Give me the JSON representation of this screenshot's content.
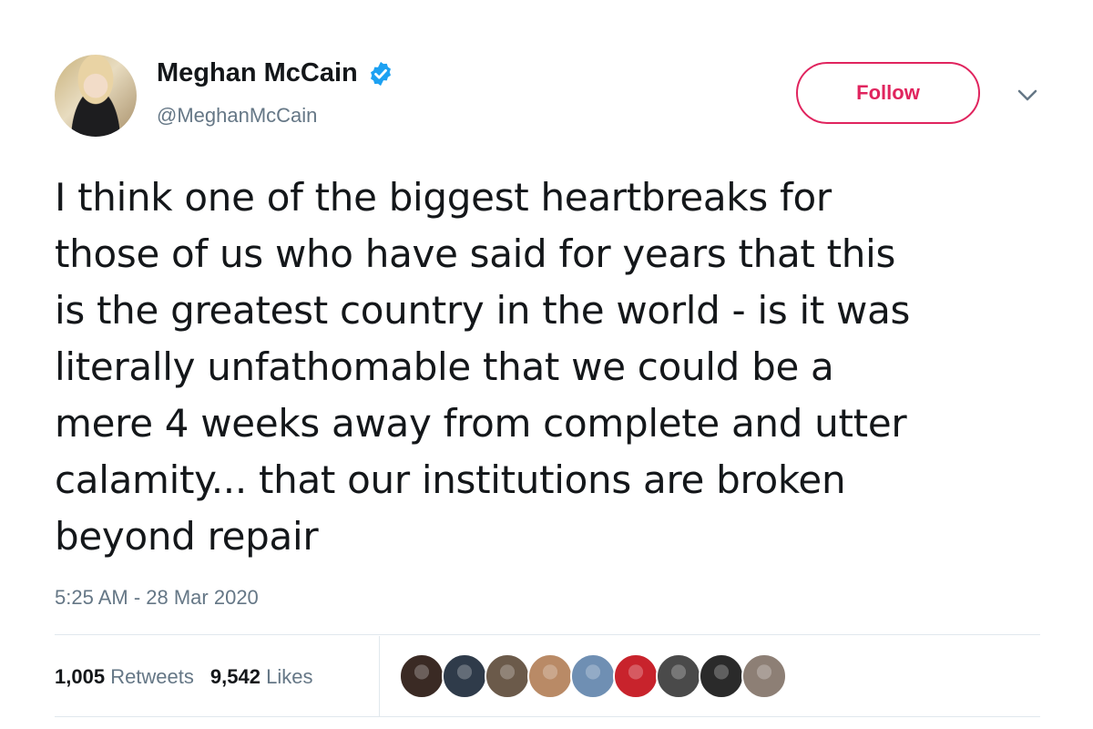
{
  "author": {
    "name": "Meghan McCain",
    "handle": "@MeghanMcCain",
    "verified": true,
    "verified_icon": "verified-badge-icon"
  },
  "actions": {
    "follow_label": "Follow",
    "caret_icon": "chevron-down-icon"
  },
  "tweet": {
    "lines": [
      "I think one of the biggest heartbreaks for",
      "those of us who have said for years that this",
      "is the greatest country in the world - is it was",
      "literally unfathomable that we could be a",
      "mere 4 weeks away from complete and utter",
      "calamity... that our institutions are broken",
      "beyond repair"
    ],
    "timestamp": "5:25 AM - 28 Mar 2020"
  },
  "stats": {
    "retweets_count": "1,005",
    "retweets_label": "Retweets",
    "likes_count": "9,542",
    "likes_label": "Likes"
  },
  "likers": [
    {
      "name": "liker-avatar-1",
      "color": "#3a2a24"
    },
    {
      "name": "liker-avatar-2",
      "color": "#2f3b4a"
    },
    {
      "name": "liker-avatar-3",
      "color": "#6b5a4a"
    },
    {
      "name": "liker-avatar-4",
      "color": "#b98a66"
    },
    {
      "name": "liker-avatar-5",
      "color": "#6f8fb3"
    },
    {
      "name": "liker-avatar-6",
      "color": "#c8232c"
    },
    {
      "name": "liker-avatar-7",
      "color": "#4a4a4a"
    },
    {
      "name": "liker-avatar-8",
      "color": "#2a2a2a"
    },
    {
      "name": "liker-avatar-9",
      "color": "#8d7f75"
    }
  ],
  "colors": {
    "text": "#14171a",
    "secondary": "#657786",
    "follow_accent": "#e0245e",
    "verified": "#1da1f2",
    "divider": "#e1e8ed"
  }
}
